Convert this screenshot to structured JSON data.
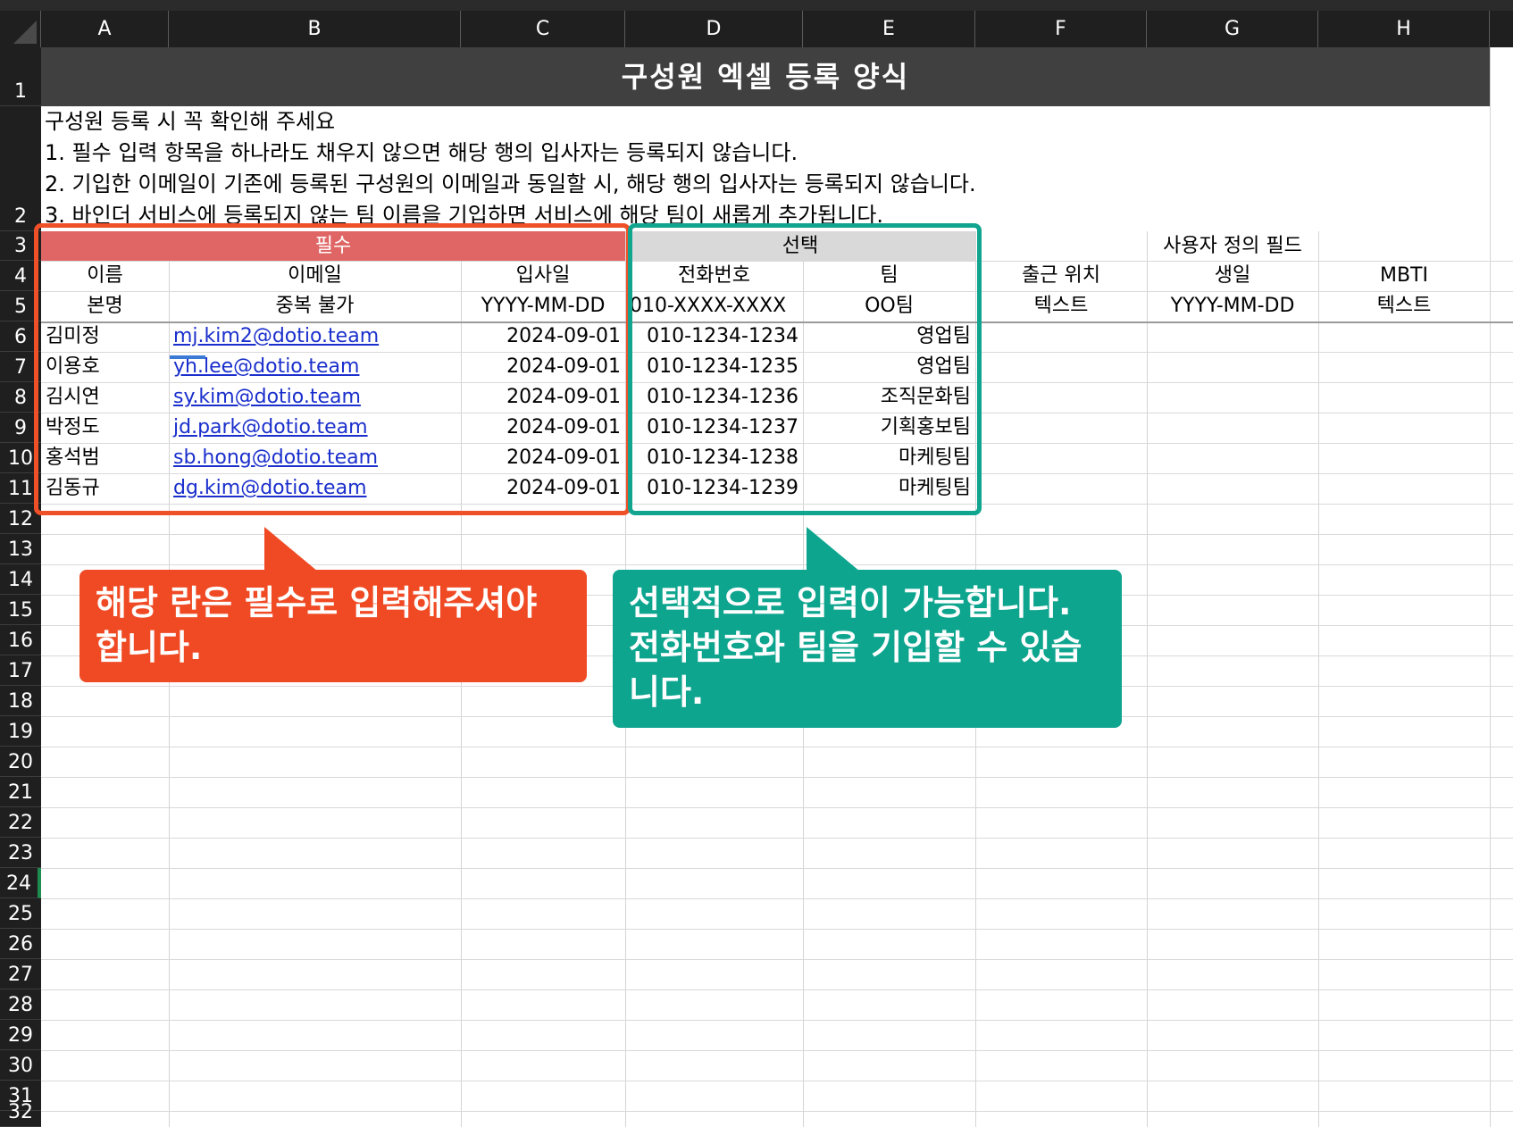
{
  "columns": [
    "A",
    "B",
    "C",
    "D",
    "E",
    "F",
    "G",
    "H"
  ],
  "rows": [
    "1",
    "2",
    "3",
    "4",
    "5",
    "6",
    "7",
    "8",
    "9",
    "10",
    "11",
    "12",
    "13",
    "14",
    "15",
    "16",
    "17",
    "18",
    "19",
    "20",
    "21",
    "22",
    "23",
    "24",
    "25",
    "26",
    "27",
    "28",
    "29",
    "30",
    "31",
    "32"
  ],
  "selected_row": "24",
  "title": "구성원 엑셀 등록 양식",
  "notes": [
    "구성원 등록 시 꼭 확인해 주세요",
    "1. 필수 입력 항목을 하나라도 채우지 않으면 해당 행의 입사자는 등록되지 않습니다.",
    "2. 기입한 이메일이 기존에 등록된 구성원의 이메일과 동일할 시, 해당 행의 입사자는 등록되지 않습니다.",
    "3. 바인더 서비스에 등록되지 않는 팀 이름을 기입하면 서비스에 해당 팀이 새롭게 추가됩니다."
  ],
  "group_headers": {
    "required": "필수",
    "optional": "선택",
    "custom": "사용자 정의 필드"
  },
  "field_headers": [
    "이름",
    "이메일",
    "입사일",
    "전화번호",
    "팀",
    "출근 위치",
    "생일",
    "MBTI"
  ],
  "field_formats": [
    "본명",
    "중복 불가",
    "YYYY-MM-DD",
    "010-XXXX-XXXX",
    "OO팀",
    "텍스트",
    "YYYY-MM-DD",
    "텍스트"
  ],
  "members": [
    {
      "name": "김미정",
      "email": "mj.kim2@dotio.team",
      "join_date": "2024-09-01",
      "phone": "010-1234-1234",
      "team": "영업팀"
    },
    {
      "name": "이용호",
      "email": "yh.lee@dotio.team",
      "join_date": "2024-09-01",
      "phone": "010-1234-1235",
      "team": "영업팀"
    },
    {
      "name": "김시연",
      "email": "sy.kim@dotio.team",
      "join_date": "2024-09-01",
      "phone": "010-1234-1236",
      "team": "조직문화팀"
    },
    {
      "name": "박정도",
      "email": "jd.park@dotio.team",
      "join_date": "2024-09-01",
      "phone": "010-1234-1237",
      "team": "기획홍보팀"
    },
    {
      "name": "홍석범",
      "email": "sb.hong@dotio.team",
      "join_date": "2024-09-01",
      "phone": "010-1234-1238",
      "team": "마케팅팀"
    },
    {
      "name": "김동규",
      "email": "dg.kim@dotio.team",
      "join_date": "2024-09-01",
      "phone": "010-1234-1239",
      "team": "마케팅팀"
    }
  ],
  "callouts": {
    "required_lines": [
      "해당 란은 필수로 입력해주셔야",
      "합니다."
    ],
    "optional_lines": [
      "선택적으로 입력이 가능합니다.",
      "전화번호와 팀을 기입할 수 있습",
      "니다."
    ]
  },
  "colors": {
    "required_accent": "#f04a24",
    "optional_accent": "#0ea58f",
    "required_header": "#e06666",
    "optional_header": "#d9d9d9",
    "title_bg": "#404040",
    "link": "#1a2fcc"
  }
}
